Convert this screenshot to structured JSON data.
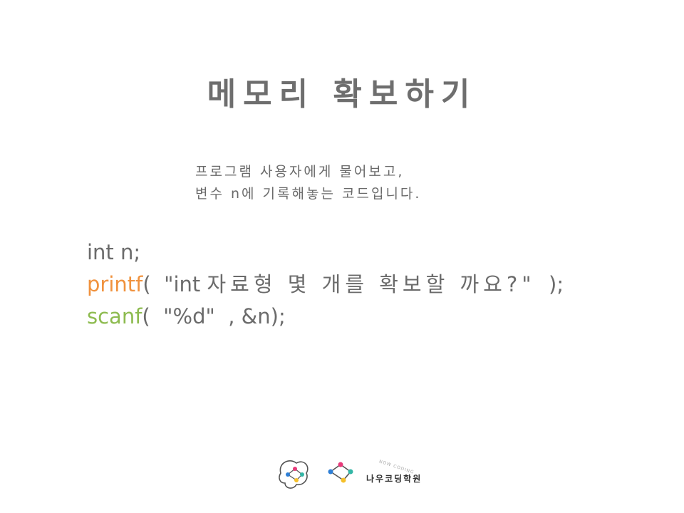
{
  "slide": {
    "title": "메모리 확보하기",
    "description_lines": [
      "프로그램 사용자에게 물어보고,",
      "변수 n에 기록해놓는 코드입니다."
    ]
  },
  "code": {
    "line1": "int n;",
    "line2": {
      "fn": "printf",
      "open": "(  \"int ",
      "korean": "자료형 몇 개를 확보할 까요?\"",
      "close": "  );"
    },
    "line3": {
      "fn": "scanf",
      "rest": "(  \"%d\"  , &n);"
    }
  },
  "colors": {
    "printf": "#f0923e",
    "scanf": "#8dbb4f",
    "text": "#6b6b6b"
  },
  "logo": {
    "brand_name": "나우코딩학원",
    "brand_en": "NOW CODING",
    "icons": [
      "brain-network-icon",
      "network-nodes-icon"
    ]
  }
}
